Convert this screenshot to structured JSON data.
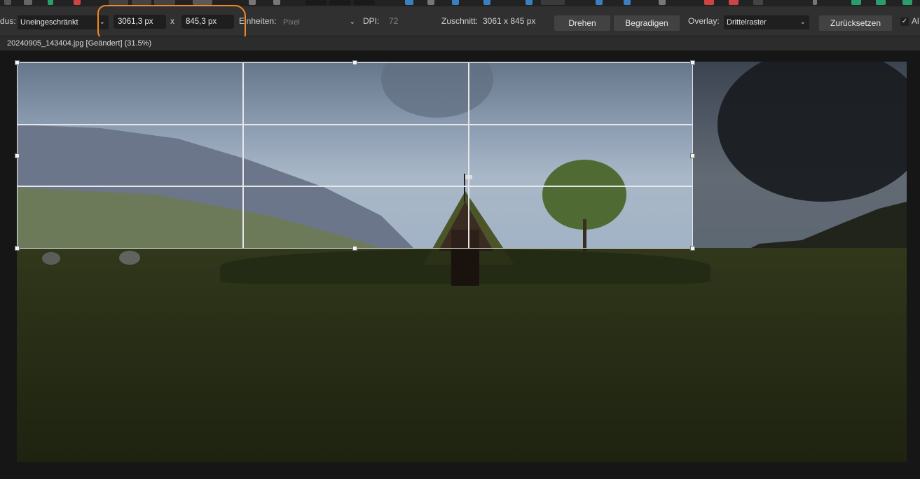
{
  "toolbar": {
    "mode_label": "dus:",
    "mode_value": "Uneingeschränkt",
    "width_value": "3061,3 px",
    "times_sign": "x",
    "height_value": "845,3 px",
    "units_label": "Einheiten:",
    "units_value": "Pixel",
    "dpi_label": "DPI:",
    "dpi_value": "72",
    "crop_label": "Zuschnitt:",
    "crop_value": "3061 x 845 px",
    "rotate_button": "Drehen",
    "straighten_button": "Begradigen",
    "overlay_label": "Overlay:",
    "overlay_value": "Drittelraster",
    "reset_button": "Zurücksetzen",
    "cut_label": "Al"
  },
  "document": {
    "tab_title": "20240905_143404.jpg [Geändert] (31.5%)"
  },
  "colors": {
    "annotation": "#f08a22",
    "toolbar_bg": "#303030",
    "button_bg": "#424242"
  },
  "icons": [
    "chevron-down-icon",
    "checkmark-icon"
  ]
}
